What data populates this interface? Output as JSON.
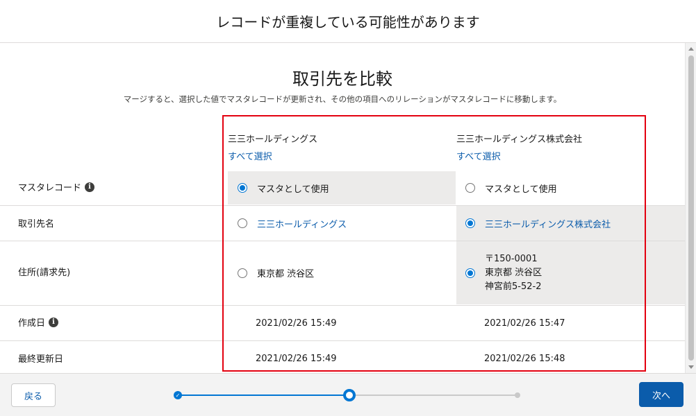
{
  "dialog": {
    "title": "レコードが重複している可能性があります"
  },
  "compare": {
    "title": "取引先を比較",
    "description": "マージすると、選択した値でマスタレコードが更新され、その他の項目へのリレーションがマスタレコードに移動します。"
  },
  "columns": [
    {
      "name": "三三ホールディングス",
      "select_all": "すべて選択"
    },
    {
      "name": "三三ホールディングス株式会社",
      "select_all": "すべて選択"
    }
  ],
  "rows": {
    "master": {
      "label": "マスタレコード",
      "has_info": true,
      "values": [
        "マスタとして使用",
        "マスタとして使用"
      ],
      "selected": 0
    },
    "name": {
      "label": "取引先名",
      "values": [
        "三三ホールディングス",
        "三三ホールディングス株式会社"
      ],
      "selected": 1
    },
    "address": {
      "label": "住所(請求先)",
      "values": [
        "東京都 渋谷区",
        "〒150-0001\n東京都 渋谷区\n神宮前5-52-2"
      ],
      "selected": 1
    },
    "created": {
      "label": "作成日",
      "has_info": true,
      "values": [
        "2021/02/26 15:49",
        "2021/02/26 15:47"
      ]
    },
    "modified": {
      "label": "最終更新日",
      "values": [
        "2021/02/26 15:49",
        "2021/02/26 15:48"
      ]
    }
  },
  "icons": {
    "info": "info-icon",
    "check": "check-icon"
  },
  "footer": {
    "back_label": "戻る",
    "next_label": "次へ",
    "progress": {
      "total_steps": 3,
      "current_step": 2
    }
  },
  "colors": {
    "brand": "#0176d3",
    "link": "#0b5cab",
    "selected_bg": "#ecebea",
    "highlight_box": "#e3000f"
  }
}
